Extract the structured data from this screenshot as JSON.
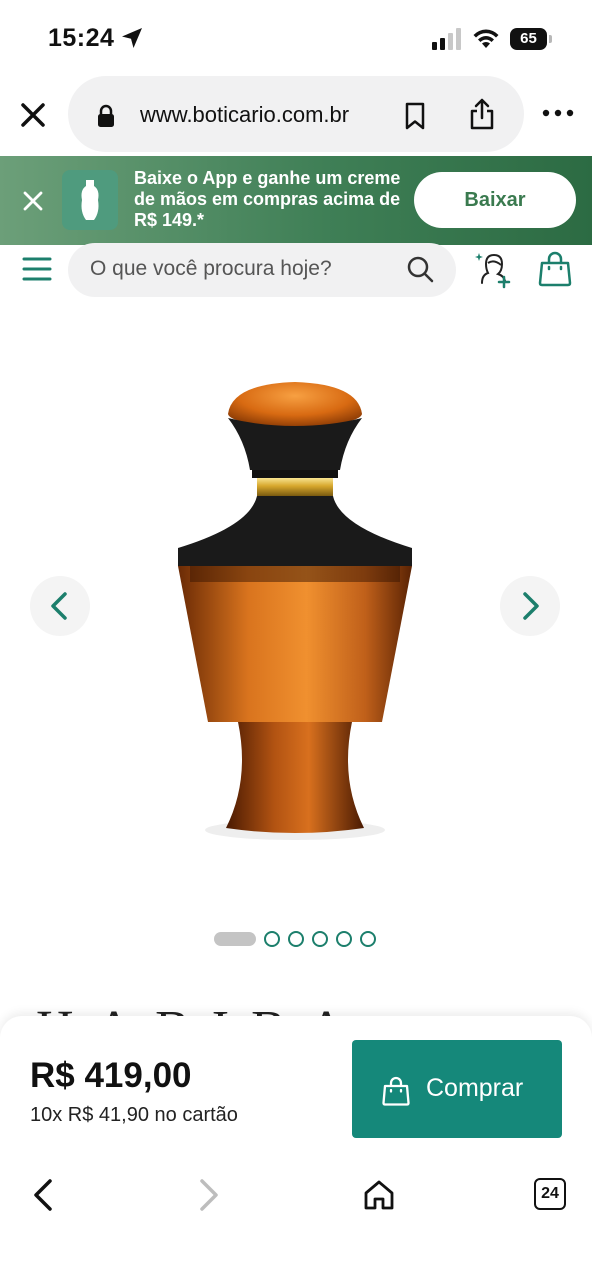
{
  "status_bar": {
    "time": "15:24",
    "battery": "65",
    "icons": [
      "location-arrow-icon",
      "signal-icon",
      "wifi-icon",
      "battery-icon"
    ]
  },
  "browser": {
    "url": "www.boticario.com.br",
    "icons": [
      "close-icon",
      "lock-icon",
      "bookmark-icon",
      "share-icon",
      "more-icon"
    ]
  },
  "app_banner": {
    "text": "Baixe o App e ganhe um creme de mãos em compras acima de R$ 149.*",
    "button_label": "Baixar",
    "colors": {
      "start": "#6c9f79",
      "end": "#2c6b43",
      "button_text": "#3a7a4f"
    }
  },
  "header": {
    "search_placeholder": "O que você procura hoje?",
    "icons": [
      "menu-icon",
      "search-icon",
      "profile-icon",
      "bag-icon"
    ]
  },
  "gallery": {
    "image_subject": "amber perfume bottle with black cap",
    "pages": 6,
    "active_page": 1
  },
  "product": {
    "title_partial": "HABIBA"
  },
  "purchase": {
    "price": "R$ 419,00",
    "installments": "10x R$ 41,90 no cartão",
    "button_label": "Comprar",
    "accent_color": "#15887a"
  },
  "toolbar": {
    "tabs_count": "24",
    "icons": [
      "back-icon",
      "forward-icon",
      "home-icon",
      "tabs-icon"
    ]
  }
}
